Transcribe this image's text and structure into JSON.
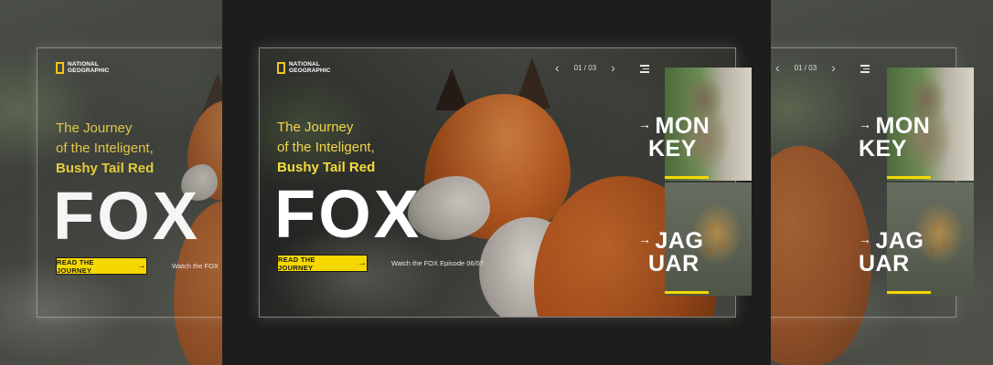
{
  "brand": {
    "logo_line1": "NATIONAL",
    "logo_line2": "GEOGRAPHIC"
  },
  "slide": {
    "tagline_line1": "The Journey",
    "tagline_line2": "of the Inteligent,",
    "tagline_line3": "Bushy Tail Red",
    "title": "FOX",
    "cta_label": "READ THE JOURNEY",
    "cta_icon": "arrow-right-icon",
    "watch_text": "Watch the FOX Episode 06/07",
    "watch_text_partial": "Watch the FOX"
  },
  "pager": {
    "current": "01 / 03",
    "prev_icon": "chevron-left-icon",
    "next_icon": "chevron-right-icon",
    "menu_icon": "menu-icon"
  },
  "thumbnails": [
    {
      "label_line1": "MON",
      "label_line2": "KEY",
      "arrow": "→"
    },
    {
      "label_line1": "JAG",
      "label_line2": "UAR",
      "arrow": "→"
    }
  ],
  "colors": {
    "accent": "#f5d800",
    "tagline": "#f1d54a",
    "background": "#1d1e1b"
  }
}
